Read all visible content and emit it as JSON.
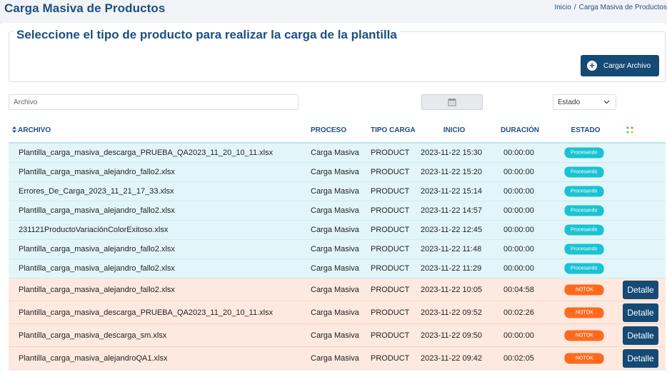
{
  "header": {
    "title": "Carga Masiva de Productos",
    "breadcrumb": {
      "home": "Inicio",
      "separator": "/",
      "current": "Carga Masiva de Productos"
    }
  },
  "upload": {
    "title": "Seleccione el tipo de producto para realizar la carga de la plantilla",
    "button_label": "Cargar Archivo"
  },
  "filters": {
    "archivo_placeholder": "Archivo",
    "estado_label": "Estado"
  },
  "table": {
    "columns": {
      "archivo": "ARCHIVO",
      "proceso": "PROCESO",
      "tipo_carga": "TIPO CARGA",
      "inicio": "INICIO",
      "duracion": "DURACIÓN",
      "estado": "ESTADO"
    },
    "detail_label": "Detalle",
    "rows": [
      {
        "archivo": "Plantilla_carga_masiva_descarga_PRUEBA_QA2023_11_20_10_11.xlsx",
        "proceso": "Carga Masiva",
        "tipo": "PRODUCT",
        "inicio": "2023-11-22 15:30",
        "duracion": "00:00:00",
        "estado": "Procesando",
        "status": "proc"
      },
      {
        "archivo": "Plantilla_carga_masiva_alejandro_fallo2.xlsx",
        "proceso": "Carga Masiva",
        "tipo": "PRODUCT",
        "inicio": "2023-11-22 15:20",
        "duracion": "00:00:00",
        "estado": "Procesando",
        "status": "proc"
      },
      {
        "archivo": "Errores_De_Carga_2023_11_21_17_33.xlsx",
        "proceso": "Carga Masiva",
        "tipo": "PRODUCT",
        "inicio": "2023-11-22 15:14",
        "duracion": "00:00:00",
        "estado": "Procesando",
        "status": "proc"
      },
      {
        "archivo": "Plantilla_carga_masiva_alejandro_fallo2.xlsx",
        "proceso": "Carga Masiva",
        "tipo": "PRODUCT",
        "inicio": "2023-11-22 14:57",
        "duracion": "00:00:00",
        "estado": "Procesando",
        "status": "proc"
      },
      {
        "archivo": "231121ProductoVariaciónColorExitoso.xlsx",
        "proceso": "Carga Masiva",
        "tipo": "PRODUCT",
        "inicio": "2023-11-22 12:45",
        "duracion": "00:00:00",
        "estado": "Procesando",
        "status": "proc"
      },
      {
        "archivo": "Plantilla_carga_masiva_alejandro_fallo2.xlsx",
        "proceso": "Carga Masiva",
        "tipo": "PRODUCT",
        "inicio": "2023-11-22 11:48",
        "duracion": "00:00:00",
        "estado": "Procesando",
        "status": "proc"
      },
      {
        "archivo": "Plantilla_carga_masiva_alejandro_fallo2.xlsx",
        "proceso": "Carga Masiva",
        "tipo": "PRODUCT",
        "inicio": "2023-11-22 11:29",
        "duracion": "00:00:00",
        "estado": "Procesando",
        "status": "proc"
      },
      {
        "archivo": "Plantilla_carga_masiva_alejandro_fallo2.xlsx",
        "proceso": "Carga Masiva",
        "tipo": "PRODUCT",
        "inicio": "2023-11-22 10:05",
        "duracion": "00:04:58",
        "estado": "NOTOK",
        "status": "notok"
      },
      {
        "archivo": "Plantilla_carga_masiva_descarga_PRUEBA_QA2023_11_20_10_11.xlsx",
        "proceso": "Carga Masiva",
        "tipo": "PRODUCT",
        "inicio": "2023-11-22 09:52",
        "duracion": "00:02:26",
        "estado": "NOTOK",
        "status": "notok"
      },
      {
        "archivo": "Plantilla_carga_masiva_descarga_sm.xlsx",
        "proceso": "Carga Masiva",
        "tipo": "PRODUCT",
        "inicio": "2023-11-22 09:50",
        "duracion": "00:00:00",
        "estado": "NOTOK",
        "status": "notok"
      },
      {
        "archivo": "Plantilla_carga_masiva_alejandroQA1.xlsx",
        "proceso": "Carga Masiva",
        "tipo": "PRODUCT",
        "inicio": "2023-11-22 09:42",
        "duracion": "00:02:05",
        "estado": "NOTOK",
        "status": "notok"
      }
    ]
  },
  "colors": {
    "brand": "#154a75",
    "title": "#1b4f82",
    "processing": "#19c3d3",
    "notok": "#ff6a1f",
    "row_processing_bg": "#e2f6fa",
    "row_notok_bg": "#fde9df"
  },
  "icons": {
    "upload": "plus-circle-icon",
    "date_filter": "calendar-icon",
    "estado_dropdown": "chevron-down-icon",
    "sort": "sort-icon",
    "columns": "column-settings-icon"
  }
}
